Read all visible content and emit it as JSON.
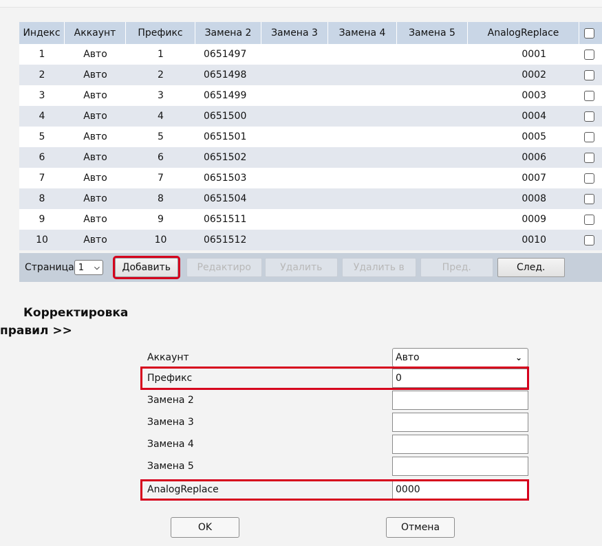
{
  "table": {
    "headers": [
      "Индекс",
      "Аккаунт",
      "Префикс",
      "Замена 2",
      "Замена 3",
      "Замена 4",
      "Замена 5",
      "AnalogReplace"
    ],
    "rows": [
      [
        "1",
        "Авто",
        "1",
        "0651497",
        "",
        "",
        "",
        "0001"
      ],
      [
        "2",
        "Авто",
        "2",
        "0651498",
        "",
        "",
        "",
        "0002"
      ],
      [
        "3",
        "Авто",
        "3",
        "0651499",
        "",
        "",
        "",
        "0003"
      ],
      [
        "4",
        "Авто",
        "4",
        "0651500",
        "",
        "",
        "",
        "0004"
      ],
      [
        "5",
        "Авто",
        "5",
        "0651501",
        "",
        "",
        "",
        "0005"
      ],
      [
        "6",
        "Авто",
        "6",
        "0651502",
        "",
        "",
        "",
        "0006"
      ],
      [
        "7",
        "Авто",
        "7",
        "0651503",
        "",
        "",
        "",
        "0007"
      ],
      [
        "8",
        "Авто",
        "8",
        "0651504",
        "",
        "",
        "",
        "0008"
      ],
      [
        "9",
        "Авто",
        "9",
        "0651511",
        "",
        "",
        "",
        "0009"
      ],
      [
        "10",
        "Авто",
        "10",
        "0651512",
        "",
        "",
        "",
        "0010"
      ]
    ]
  },
  "pager": {
    "page_label": "Страница",
    "page_value": "1",
    "add": "Добавить",
    "edit": "Редактиро",
    "delete": "Удалить",
    "delete_all": "Удалить в",
    "prev": "Пред.",
    "next": "След."
  },
  "form": {
    "title_line1": "Корректировка",
    "title_line2": "правил >>",
    "fields": [
      {
        "label": "Аккаунт",
        "value": "Авто"
      },
      {
        "label": "Префикс",
        "value": "0"
      },
      {
        "label": "Замена 2",
        "value": ""
      },
      {
        "label": "Замена 3",
        "value": ""
      },
      {
        "label": "Замена 4",
        "value": ""
      },
      {
        "label": "Замена 5",
        "value": ""
      },
      {
        "label": "AnalogReplace",
        "value": "0000"
      }
    ],
    "ok": "OK",
    "cancel": "Отмена"
  },
  "colors": {
    "header_bg": "#c9d6e6",
    "stripe": "#e3e7ee",
    "pager_bg": "#c6cfda",
    "highlight": "#d6001c"
  },
  "icons": {
    "dropdown": "chevron-down-icon",
    "checkbox": "checkbox-icon"
  }
}
